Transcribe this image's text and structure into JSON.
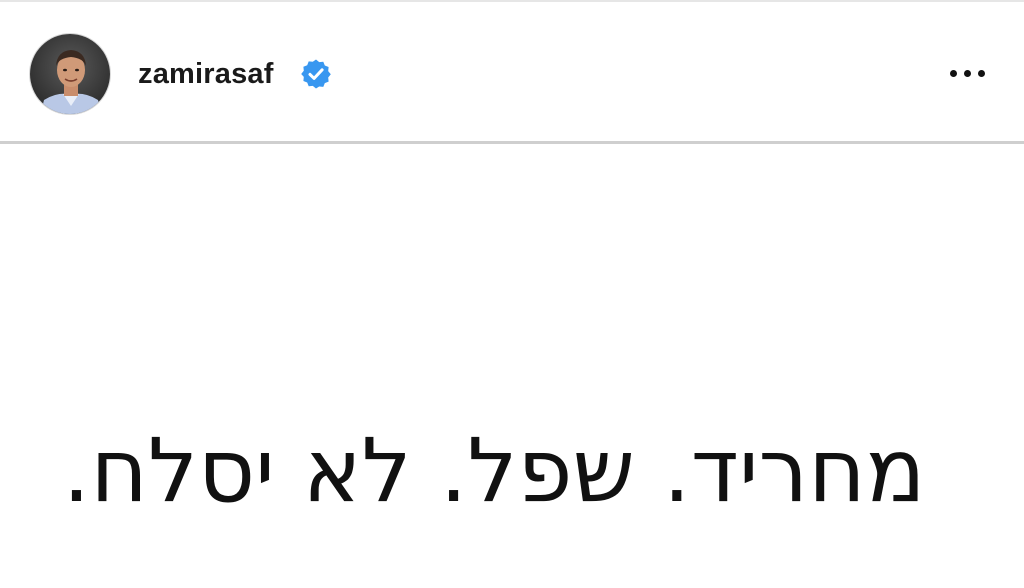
{
  "post": {
    "author": {
      "username": "zamirasaf",
      "verified": true,
      "avatar_icon": "profile-photo"
    },
    "more_icon": "more-horizontal-icon",
    "text": "מחריד. שפל. לא יסלח."
  },
  "colors": {
    "verified_badge": "#3897f0",
    "text": "#111111",
    "divider": "#cfcfcf"
  }
}
